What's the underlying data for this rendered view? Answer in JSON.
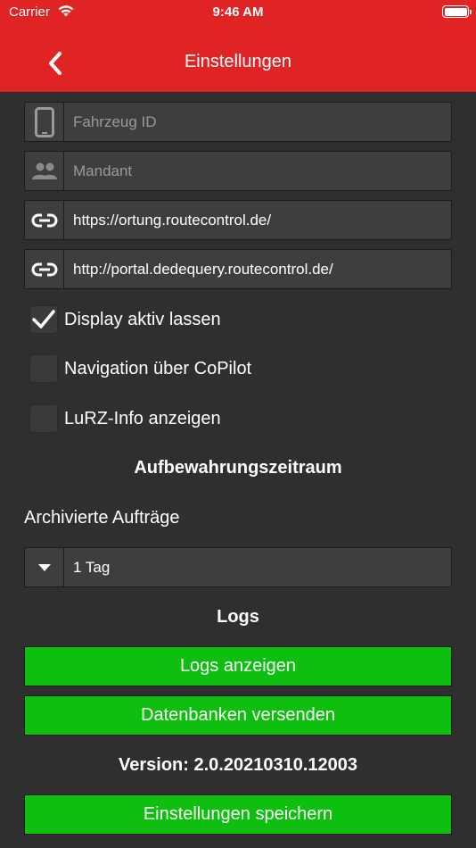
{
  "status_bar": {
    "carrier": "Carrier",
    "time": "9:46 AM",
    "wifi_icon": "wifi-icon",
    "battery_icon": "battery-icon"
  },
  "header": {
    "title": "Einstellungen",
    "back_icon": "chevron-left-icon",
    "color": "#e02424"
  },
  "fields": {
    "vehicle_id": {
      "placeholder": "Fahrzeug ID",
      "value": "",
      "icon": "phone-icon"
    },
    "client": {
      "placeholder": "Mandant",
      "value": "",
      "icon": "people-icon"
    },
    "tracking_url": {
      "value": "https://ortung.routecontrol.de/",
      "icon": "link-icon"
    },
    "portal_url": {
      "value": "http://portal.dedequery.routecontrol.de/",
      "icon": "link-icon"
    }
  },
  "checkboxes": [
    {
      "label": "Display aktiv lassen",
      "checked": true
    },
    {
      "label": "Navigation über CoPilot",
      "checked": false
    },
    {
      "label": "LuRZ-Info anzeigen",
      "checked": false
    }
  ],
  "retention": {
    "heading": "Aufbewahrungszeitraum",
    "archived_label": "Archivierte Aufträge",
    "selected": "1 Tag",
    "icon": "caret-down-icon"
  },
  "logs": {
    "heading": "Logs",
    "show_logs_button": "Logs anzeigen",
    "send_db_button": "Datenbanken versenden"
  },
  "version_text": "Version: 2.0.20210310.12003",
  "save_button": "Einstellungen speichern",
  "colors": {
    "background": "#2f2f2f",
    "button_green": "#0fbf0f",
    "field_bg": "#3e3e3e"
  }
}
